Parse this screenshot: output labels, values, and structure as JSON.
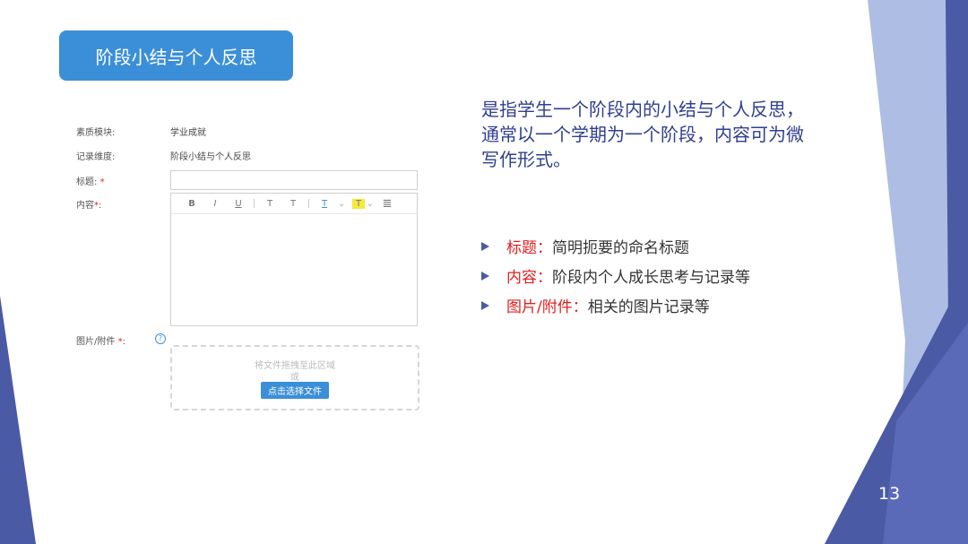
{
  "title": "阶段小结与个人反思",
  "form": {
    "module_label": "素质模块:",
    "module_value": "学业成就",
    "dimension_label": "记录维度:",
    "dimension_value": "阶段小结与个人反思",
    "title_label": "标题:",
    "title_required": "*",
    "content_label": "内容",
    "content_required": "*",
    "content_colon": ":",
    "attachment_label": "图片/附件",
    "attachment_required": "*",
    "attachment_colon": ":",
    "help_icon": "question-circle-icon",
    "dropzone_hint": "将文件拖拽至此区域",
    "dropzone_or": "或",
    "select_file_button": "点击选择文件"
  },
  "toolbar": {
    "bold": "B",
    "italic": "I",
    "underline": "U",
    "superscript": "T",
    "subscript": "T",
    "font_color": "T",
    "bg_color": "T",
    "align": "≣"
  },
  "description": "是指学生一个阶段内的小结与个人反思，通常以一个学期为一个阶段，内容可为微写作形式。",
  "bullets": [
    {
      "key": "标题：",
      "text": "简明扼要的命名标题"
    },
    {
      "key": "内容：",
      "text": "阶段内个人成长思考与记录等"
    },
    {
      "key": "图片/附件：",
      "text": "相关的图片记录等"
    }
  ],
  "page_number": "13",
  "colors": {
    "accent": "#3b8fd8",
    "deco_dark": "#4a5aa5",
    "deco_light": "#8a9bd1",
    "required": "#e02020"
  }
}
